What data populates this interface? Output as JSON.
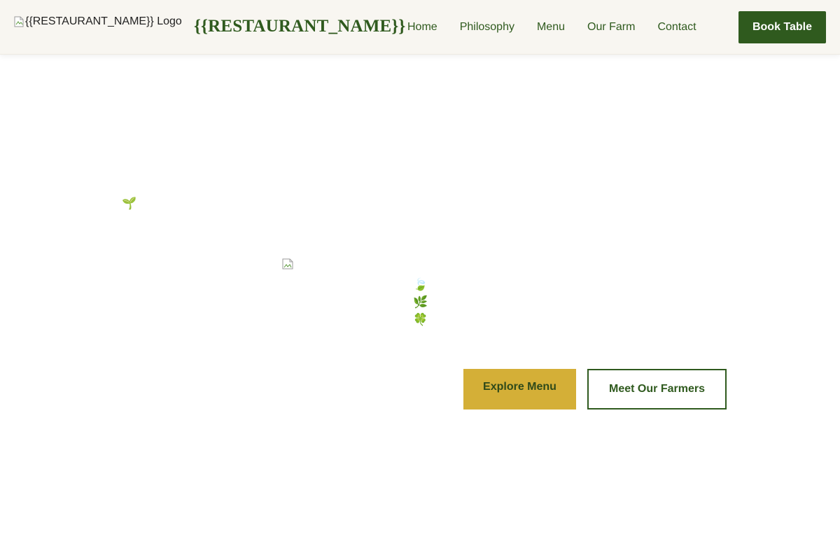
{
  "header": {
    "logo_alt": "{{RESTAURANT_NAME}} Logo",
    "brand_name": "{{RESTAURANT_NAME}}",
    "nav": [
      {
        "label": "Home"
      },
      {
        "label": "Philosophy"
      },
      {
        "label": "Menu"
      },
      {
        "label": "Our Farm"
      },
      {
        "label": "Contact"
      }
    ],
    "book_label": "Book Table"
  },
  "hero": {
    "decor": {
      "seedling": "🌱",
      "leaf_1": "🍃",
      "leaf_2": "🌿",
      "leaf_3": "🍀"
    },
    "primary_cta": "Explore Menu",
    "secondary_cta": "Meet Our Farmers"
  },
  "colors": {
    "brand_green": "#2f5a1e",
    "accent_gold": "#d4af37",
    "header_bg": "#f8f6f1"
  }
}
